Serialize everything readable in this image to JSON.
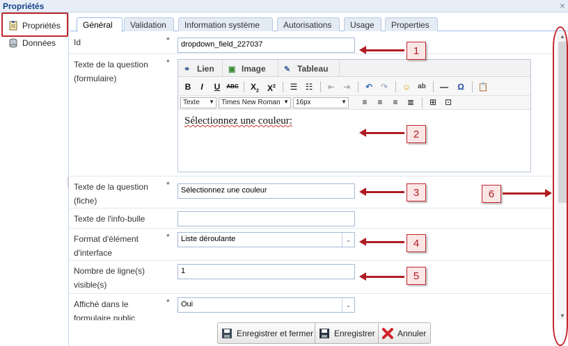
{
  "window": {
    "title": "Propriétés",
    "close_glyph": "×"
  },
  "sidebar": {
    "items": [
      {
        "label": "Propriétés",
        "icon": "properties-icon"
      },
      {
        "label": "Données",
        "icon": "database-icon"
      }
    ]
  },
  "tabs": [
    "Général",
    "Validation",
    "Information système",
    "Autorisations",
    "Usage",
    "Properties"
  ],
  "active_tab": "Général",
  "form": {
    "required_mark": "*",
    "id": {
      "label": "Id",
      "value": "dropdown_field_227037"
    },
    "question_form": {
      "label": "Texte de la question (formulaire)"
    },
    "question_fiche": {
      "label": "Texte de la question (fiche)",
      "value": "Sélectionnez une couleur"
    },
    "tooltip": {
      "label": "Texte de l'info-bulle",
      "value": ""
    },
    "format": {
      "label": "Format d'élément d'interface",
      "value": "Liste déroulante"
    },
    "lines": {
      "label": "Nombre de ligne(s) visible(s)",
      "value": "1"
    },
    "public": {
      "label": "Affiché dans le formulaire public",
      "value": "Oui"
    }
  },
  "editor": {
    "tabs": [
      {
        "label": "Lien",
        "icon": "link-icon"
      },
      {
        "label": "Image",
        "icon": "image-icon"
      },
      {
        "label": "Tableau",
        "icon": "table-icon"
      }
    ],
    "format_select": "Texte",
    "font_select": "Times New Roman",
    "size_select": "16px",
    "content": "Sélectionnez une couleur:"
  },
  "buttons": {
    "save_close": "Enregistrer et fermer",
    "save": "Enregistrer",
    "cancel": "Annuler"
  },
  "annotations": [
    "1",
    "2",
    "3",
    "4",
    "5",
    "6"
  ],
  "colors": {
    "accent": "#c0262c",
    "header": "#15428b"
  }
}
